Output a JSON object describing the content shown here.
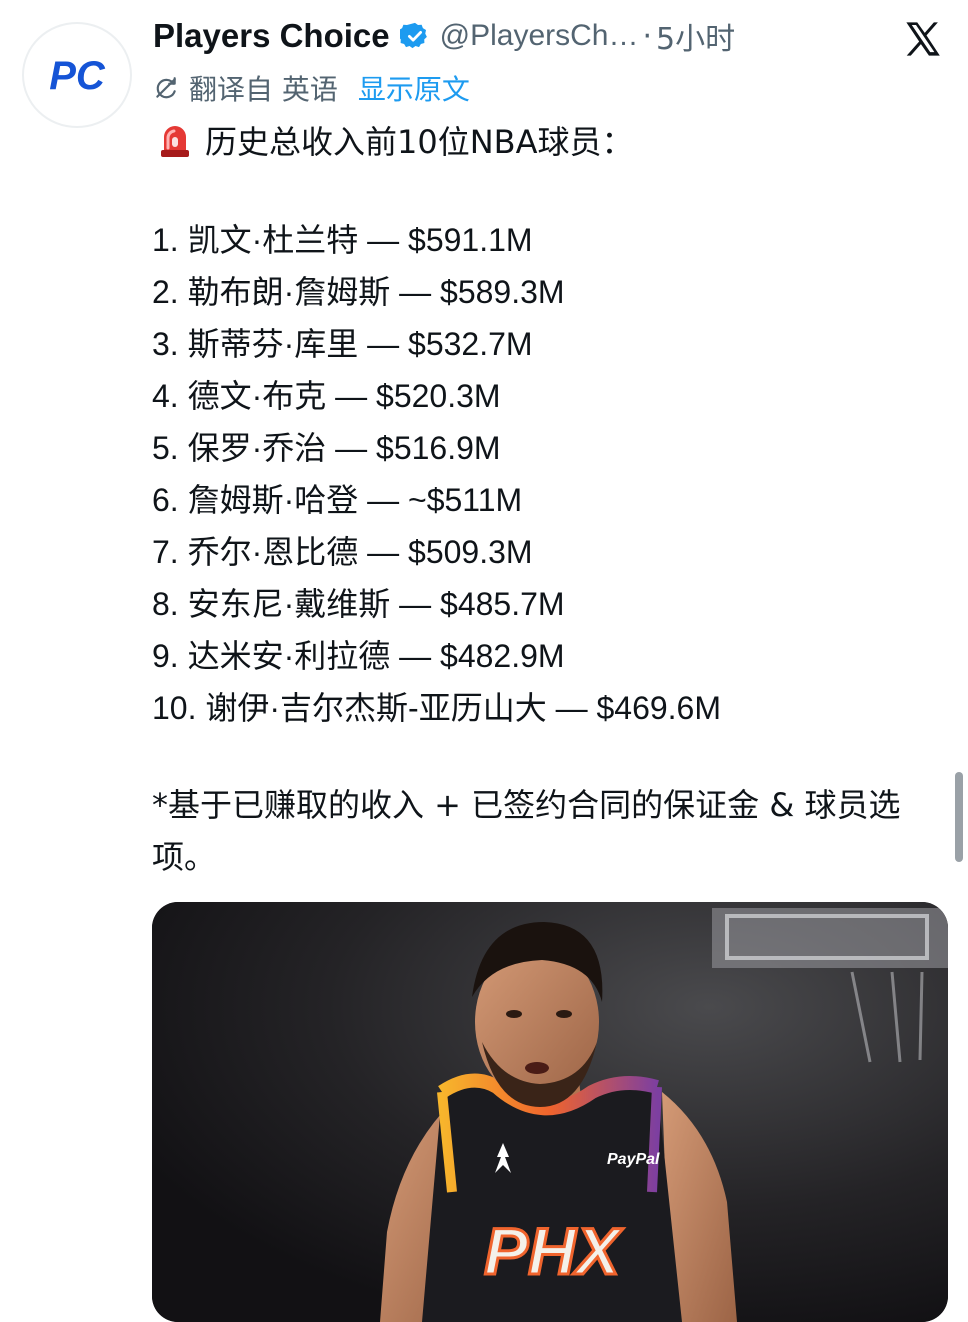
{
  "tweet": {
    "author": {
      "display_name": "Players Choice",
      "handle": "@PlayersCh…",
      "avatar_text": "PC",
      "verified_icon": "verified-badge-icon"
    },
    "separator": "·",
    "timestamp": "5小时",
    "platform_icon": "x-logo-icon",
    "translation": {
      "label": "翻译自 英语",
      "show_original": "显示原文"
    },
    "headline": "历史总收入前10位NBA球员：",
    "ranking": [
      "1. 凯文·杜兰特 — $591.1M",
      "2. 勒布朗·詹姆斯 — $589.3M",
      "3. 斯蒂芬·库里 — $532.7M",
      "4. 德文·布克 — $520.3M",
      "5. 保罗·乔治 — $516.9M",
      "6. 詹姆斯·哈登 — ~$511M",
      "7. 乔尔·恩比德 — $509.3M",
      "8. 安东尼·戴维斯 — $485.7M",
      "9. 达米安·利拉德 — $482.9M",
      "10. 谢伊·吉尔杰斯-亚历山大 — $469.6M"
    ],
    "footnote": "*基于已赚取的收入 + 已签约合同的保证金 & 球员选项。",
    "media": {
      "jersey_text": "PHX",
      "sponsor_text": "PayPal"
    }
  },
  "colors": {
    "text": "#0f1419",
    "secondary": "#536471",
    "link": "#1d9bf0",
    "avatar_blue": "#1554d6",
    "verified": "#1d9bf0"
  }
}
